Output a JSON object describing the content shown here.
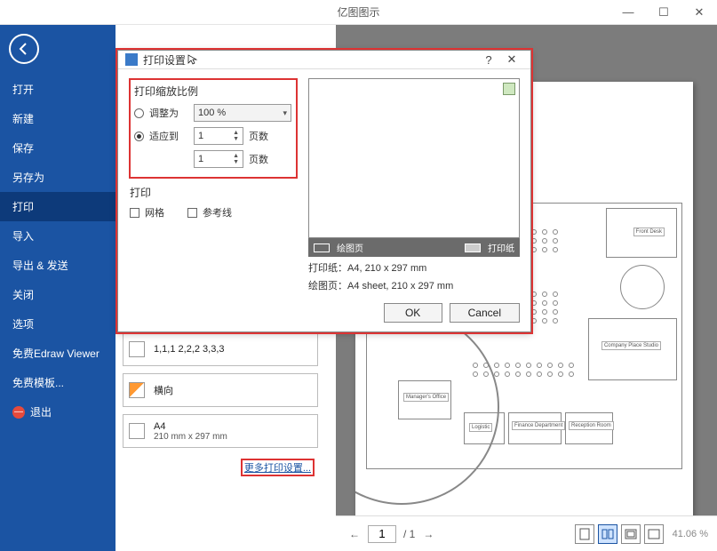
{
  "title": "亿图图示",
  "window": {
    "min": "—",
    "max": "☐",
    "close": "✕"
  },
  "sidebar": {
    "items": [
      "打开",
      "新建",
      "保存",
      "另存为",
      "打印",
      "导入",
      "导出 & 发送",
      "关闭",
      "选项",
      "免费Edraw Viewer",
      "免费模板..."
    ],
    "exit_label": "退出",
    "selected_index": 4
  },
  "card_collate": {
    "label": "1,1,1  2,2,2  3,3,3"
  },
  "card_orientation": {
    "label": "横向"
  },
  "card_paper": {
    "label": "A4",
    "sub": "210 mm x 297 mm"
  },
  "more_link": "更多打印设置...",
  "dialog": {
    "title": "打印设置",
    "help": "?",
    "close": "✕",
    "group_scale_title": "打印缩放比例",
    "radio_adjust": "调整为",
    "radio_fit": "适应到",
    "scale_value": "100 %",
    "pages_value_1": "1",
    "pages_value_2": "1",
    "pages_label": "页数",
    "group_print_title": "打印",
    "chk_grid": "网格",
    "chk_guides": "参考线",
    "legend_drawing": "绘图页",
    "legend_printer": "打印纸",
    "info_print_paper": "打印纸：A4, 210 x 297 mm",
    "info_draw_page": "绘图页：A4 sheet, 210 x 297 mm",
    "ok": "OK",
    "cancel": "Cancel"
  },
  "pager": {
    "current": "1",
    "total": "/ 1"
  },
  "zoom": "41.06 %",
  "plan_labels": {
    "front": "Front Desk",
    "conf": "Company Place Studio",
    "office": "Manager's Office",
    "logistic": "Logistic",
    "finance": "Finance Department",
    "reception": "Reception Room"
  }
}
